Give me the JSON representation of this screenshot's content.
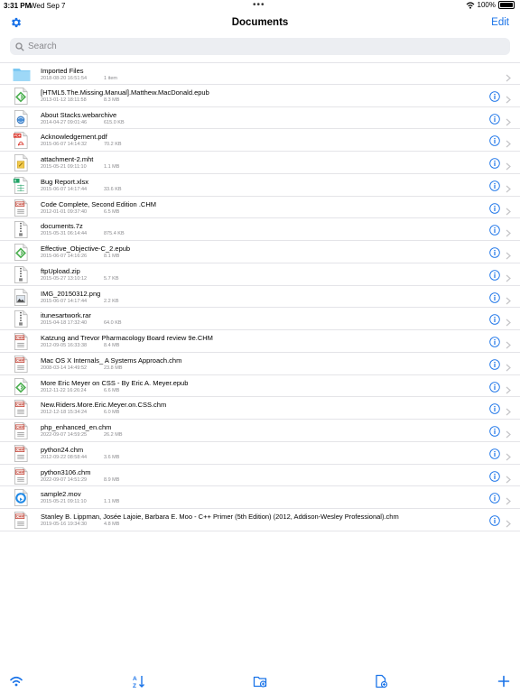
{
  "status": {
    "time": "3:31 PM",
    "date": "Wed Sep 7",
    "battery": "100%"
  },
  "nav": {
    "title": "Documents",
    "edit": "Edit"
  },
  "search": {
    "placeholder": "Search"
  },
  "colors": {
    "accent": "#1a73e8",
    "folder": "#7cc8f2",
    "pdf": "#d93025",
    "epub": "#4caf50",
    "chm": "#c0392b"
  },
  "files": [
    {
      "name": "Imported Files",
      "date": "2018-08-20 16:51:54",
      "size": "1 item",
      "icon": "folder-icon",
      "info": false
    },
    {
      "name": "[HTML5.The.Missing.Manual].Matthew.MacDonald.epub",
      "date": "2013-01-12 18:11:58",
      "size": "8.3 MB",
      "icon": "epub-file-icon",
      "info": true
    },
    {
      "name": "About Stacks.webarchive",
      "date": "2014-04-27 09:01:46",
      "size": "615.0 KB",
      "icon": "webarchive-file-icon",
      "info": true
    },
    {
      "name": "Acknowledgement.pdf",
      "date": "2015-06-07 14:14:32",
      "size": "70.2 KB",
      "icon": "pdf-file-icon",
      "info": true
    },
    {
      "name": "attachment-2.mht",
      "date": "2015-05-21 09:11:10",
      "size": "1.1 MB",
      "icon": "mht-file-icon",
      "info": true
    },
    {
      "name": "Bug Report.xlsx",
      "date": "2015-06-07 14:17:44",
      "size": "33.6 KB",
      "icon": "xlsx-file-icon",
      "info": true
    },
    {
      "name": "Code Complete, Second Edition .CHM",
      "date": "2012-01-01 09:37:40",
      "size": "6.5 MB",
      "icon": "chm-file-icon",
      "info": true
    },
    {
      "name": "documents.7z",
      "date": "2015-05-31 06:14:44",
      "size": "875.4 KB",
      "icon": "archive-file-icon",
      "info": true
    },
    {
      "name": "Effective_Objective-C_2.epub",
      "date": "2015-06-07 14:16:26",
      "size": "8.1 MB",
      "icon": "epub-file-icon",
      "info": true
    },
    {
      "name": "ftpUpload.zip",
      "date": "2015-05-27 13:10:12",
      "size": "5.7 KB",
      "icon": "zip-file-icon",
      "info": true
    },
    {
      "name": "IMG_20150312.png",
      "date": "2015-06-07 14:17:44",
      "size": "2.2 KB",
      "icon": "image-file-icon",
      "info": true
    },
    {
      "name": "itunesartwork.rar",
      "date": "2015-04-18 17:32:40",
      "size": "64.0 KB",
      "icon": "rar-file-icon",
      "info": true
    },
    {
      "name": "Katzung and Trevor Pharmacology Board review 9e.CHM",
      "date": "2012-09-05 16:33:38",
      "size": "8.4 MB",
      "icon": "chm-file-icon",
      "info": true
    },
    {
      "name": "Mac OS X Internals_ A Systems Approach.chm",
      "date": "2008-03-14 14:49:52",
      "size": "23.8 MB",
      "icon": "chm-file-icon",
      "info": true
    },
    {
      "name": "More Eric Meyer on CSS - By Eric A. Meyer.epub",
      "date": "2012-11-22 16:26:24",
      "size": "6.6 MB",
      "icon": "epub-file-icon",
      "info": true
    },
    {
      "name": "New.Riders.More.Eric.Meyer.on.CSS.chm",
      "date": "2012-12-18 15:34:24",
      "size": "6.0 MB",
      "icon": "chm-file-icon",
      "info": true
    },
    {
      "name": "php_enhanced_en.chm",
      "date": "2022-09-07 14:59:25",
      "size": "26.2 MB",
      "icon": "chm-file-icon",
      "info": true
    },
    {
      "name": "python24.chm",
      "date": "2012-09-22 08:58:44",
      "size": "3.6 MB",
      "icon": "chm-file-icon",
      "info": true
    },
    {
      "name": "python3106.chm",
      "date": "2022-09-07 14:51:29",
      "size": "8.9 MB",
      "icon": "chm-file-icon",
      "info": true
    },
    {
      "name": "sample2.mov",
      "date": "2015-05-21 09:11:10",
      "size": "1.1 MB",
      "icon": "video-file-icon",
      "info": true
    },
    {
      "name": "Stanley B. Lippman, Josée Lajoie, Barbara E. Moo - C++ Primer (5th Edition) (2012, Addison-Wesley Professional).chm",
      "date": "2019-05-16 19:34:30",
      "size": "4.8 MB",
      "icon": "chm-file-icon",
      "info": true
    }
  ],
  "toolbar": [
    {
      "name": "wifi-transfer-icon"
    },
    {
      "name": "sort-az-icon"
    },
    {
      "name": "new-folder-icon"
    },
    {
      "name": "new-file-icon"
    },
    {
      "name": "add-icon"
    }
  ]
}
